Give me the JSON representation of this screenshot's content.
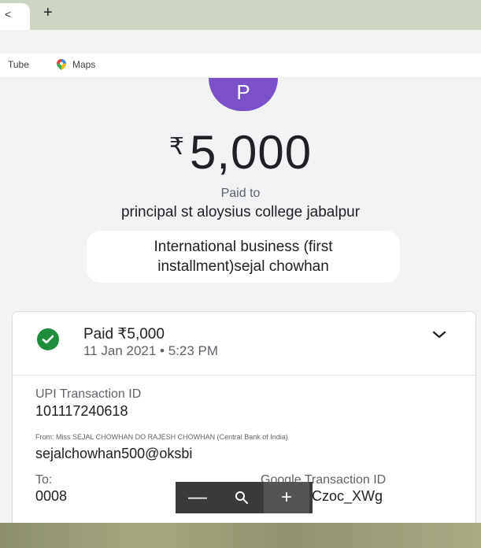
{
  "browser": {
    "tab_close_glyph": "<",
    "new_tab_glyph": "+",
    "bookmarks": [
      {
        "label": "Tube"
      },
      {
        "label": "Maps"
      }
    ]
  },
  "payment": {
    "avatar_letter": "P",
    "currency_symbol": "₹",
    "amount": "5,000",
    "paid_to_label": "Paid to",
    "payee": "principal st aloysius college jabalpur",
    "note": "International business (first installment)sejal chowhan"
  },
  "details": {
    "status": "Paid ₹5,000",
    "datetime": "11 Jan 2021 • 5:23 PM",
    "upi_label": "UPI Transaction ID",
    "upi_id": "101117240618",
    "from_label": "From: Miss SEJAL  CHOWHAN DO RAJESH CHOWHAN (Central Bank of India)",
    "from_upi": "sejalchowhan500@oksbi",
    "to_label": "To:",
    "to_value": "0008",
    "google_label": "Google Transaction ID",
    "google_value": "CICAgKCzoc_XWg"
  },
  "viewer": {
    "zoom_out": "—",
    "zoom_in": "+"
  },
  "colors": {
    "avatar": "#7b51c9",
    "success": "#1e8e3e"
  }
}
